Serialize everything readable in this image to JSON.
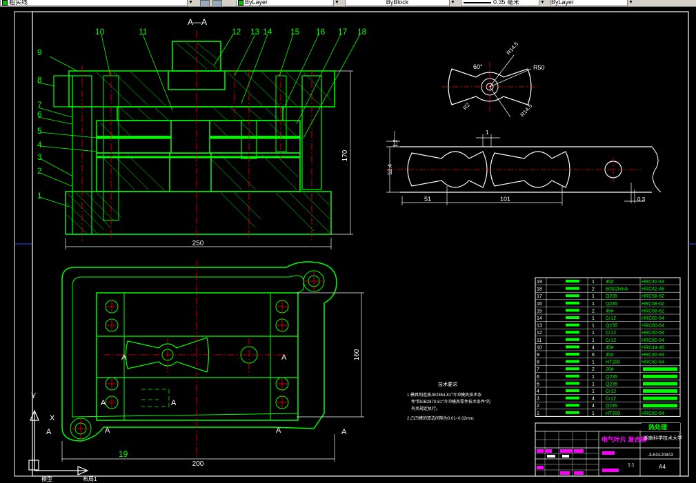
{
  "toolbar": {
    "linetype": "粗实线",
    "color": "ByLayer",
    "linetype2": "ByBlock",
    "lineweight": "0.35 毫米",
    "plotstyle": "ByLayer"
  },
  "drawing": {
    "section_title": "A—A",
    "dim_170": "170",
    "dim_250": "250",
    "dim_160": "160",
    "dim_200": "200",
    "dim_51": "51",
    "dim_101": "101",
    "dim_12": "1.2",
    "dim_524": "52.4",
    "dim_03": "0.3",
    "dim_1": "1",
    "dim_r50": "R50",
    "dim_60": "60°",
    "dim_r2": "R2",
    "dim_r14": "R14.5",
    "part_numbers": [
      "1",
      "2",
      "3",
      "4",
      "5",
      "6",
      "7",
      "8",
      "9",
      "10",
      "11",
      "12",
      "13",
      "14",
      "15",
      "16",
      "17",
      "18",
      "19"
    ],
    "section_mark": "A",
    "tech_title": "技术要求",
    "tech_note1a": "1.模具制造按JB2854-81\"冷冲模具技术条",
    "tech_note1b": "件\"和GB2870-81\"冷冲模具零件技术条件\"的",
    "tech_note1c": "有关规定执行。",
    "tech_note2": "2.凸凹模的双边间隙为0.01~0.02mm;",
    "ucs_y": "Y",
    "ucs_x": "X"
  },
  "bom": [
    {
      "no": "19",
      "qty": "1",
      "mat": "45#",
      "heat": "HRC40-44"
    },
    {
      "no": "18",
      "qty": "2",
      "mat": "60Si2MnA",
      "heat": "HRC42-46"
    },
    {
      "no": "17",
      "qty": "1",
      "mat": "Q235",
      "heat": "HRC58-62"
    },
    {
      "no": "16",
      "qty": "1",
      "mat": "Q235",
      "heat": "HRC58-62"
    },
    {
      "no": "15",
      "qty": "2",
      "mat": "45#",
      "heat": "HRC58-62"
    },
    {
      "no": "14",
      "qty": "1",
      "mat": "Cr12",
      "heat": "HRC60-64"
    },
    {
      "no": "13",
      "qty": "1",
      "mat": "Q235",
      "heat": "HRC60-64"
    },
    {
      "no": "12",
      "qty": "1",
      "mat": "Cr12",
      "heat": "HRC60-64"
    },
    {
      "no": "11",
      "qty": "1",
      "mat": "Cr12",
      "heat": "HRC60-64"
    },
    {
      "no": "10",
      "qty": "4",
      "mat": "45#",
      "heat": "HRC44-48"
    },
    {
      "no": "9",
      "qty": "6",
      "mat": "45#",
      "heat": "HRC40-44"
    },
    {
      "no": "8",
      "qty": "1",
      "mat": "HT200",
      "heat": "HRC60-64"
    },
    {
      "no": "7",
      "qty": "2",
      "mat": "20#",
      "heat": ""
    },
    {
      "no": "6",
      "qty": "1",
      "mat": "Q235",
      "heat": ""
    },
    {
      "no": "5",
      "qty": "1",
      "mat": "Q235",
      "heat": ""
    },
    {
      "no": "4",
      "qty": "1",
      "mat": "Cr12",
      "heat": ""
    },
    {
      "no": "3",
      "qty": "4",
      "mat": "Cr12",
      "heat": ""
    },
    {
      "no": "2",
      "qty": "4",
      "mat": "Q235",
      "heat": ""
    },
    {
      "no": "1",
      "qty": "1",
      "mat": "HT200",
      "heat": "HRC60-64"
    }
  ],
  "titleblock": {
    "heading": "热处理",
    "name": "电气叶片 复合模",
    "school": "湖南科学技术大学",
    "scale": "1:1",
    "sheet": "A4",
    "code": "JLKG1208A3"
  },
  "tabs": [
    "模型",
    "布局1"
  ]
}
